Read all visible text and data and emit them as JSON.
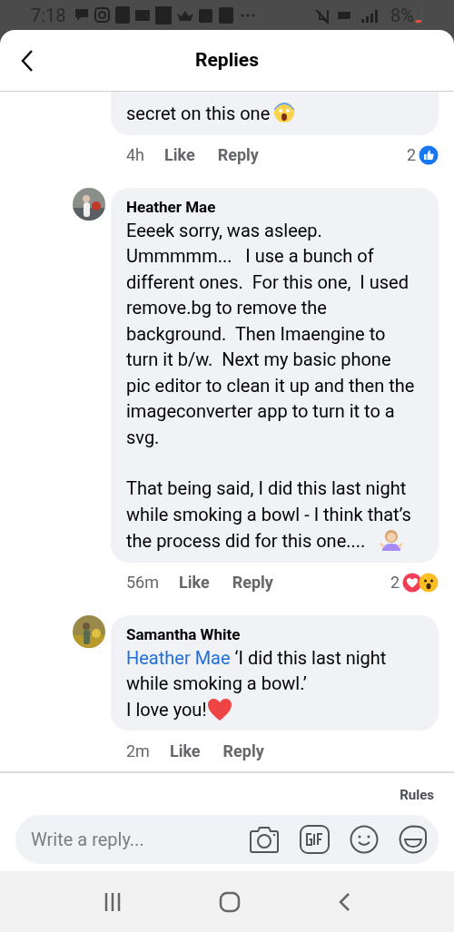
{
  "status_bar": {
    "time": "7:18",
    "battery": "8%"
  },
  "header": {
    "title": "Replies"
  },
  "comments": [
    {
      "cut_top": true,
      "paragraphs": [
        {
          "text": "secret on this one"
        }
      ],
      "emoji": {
        "kind": "scream"
      },
      "time": "4h",
      "like": "Like",
      "reply": "Reply",
      "reaction_count": "2",
      "reactions": [
        {
          "kind": "like"
        }
      ]
    },
    {
      "author": "Heather Mae",
      "cut_top": false,
      "paragraphs": [
        {
          "text": "Eeeek sorry, was asleep.  Ummmmm...   I use a bunch of different ones.  For this one,  I used remove.bg to remove the background.  Then Imaengine to turn it b/w.  Next my basic phone pic editor to clean it up and then the imageconverter app to turn it to a svg."
        },
        {
          "text": "That being said, I did this last night while smoking a bowl - I think that’s the process did for this one....   "
        }
      ],
      "emoji": {
        "kind": "shrug"
      },
      "time": "56m",
      "like": "Like",
      "reply": "Reply",
      "reaction_count": "2",
      "reactions": [
        {
          "kind": "love"
        },
        {
          "kind": "wow"
        }
      ]
    },
    {
      "author": "Samantha White",
      "cut_top": false,
      "paragraphs": [
        {
          "mention": "Heather Mae",
          "text": "‘I did this last night while smoking a bowl.’"
        },
        {
          "text": "I love you!"
        }
      ],
      "emoji": {
        "kind": "heart"
      },
      "time": "2m",
      "like": "Like",
      "reply": "Reply"
    }
  ],
  "composer": {
    "rules": "Rules",
    "placeholder": "Write a reply..."
  }
}
